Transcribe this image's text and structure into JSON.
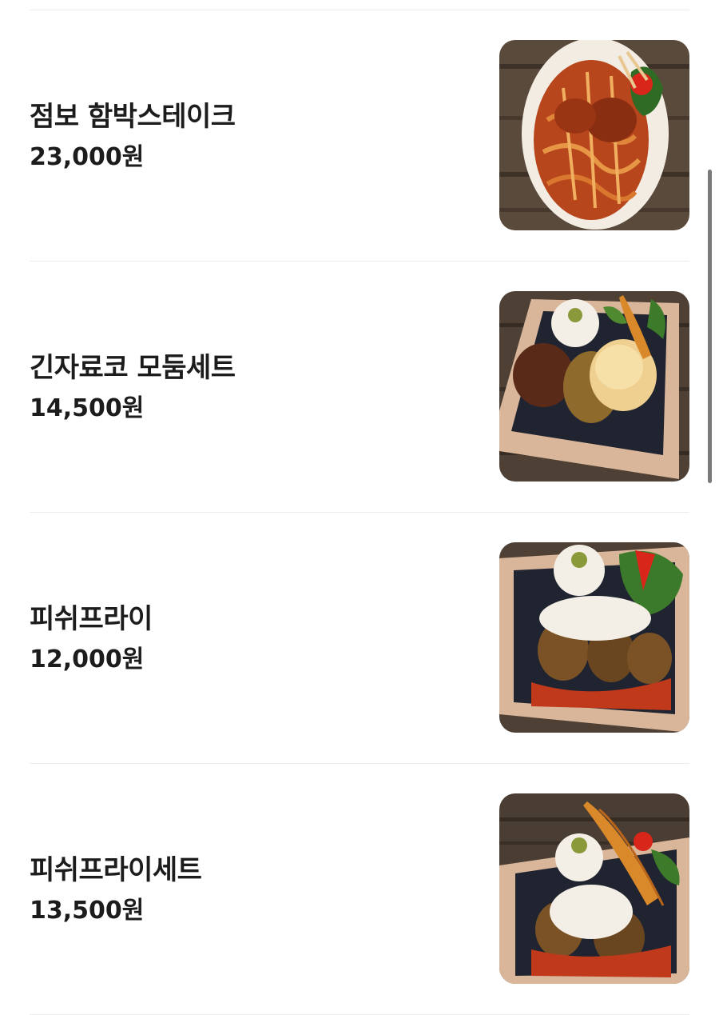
{
  "menu": {
    "items": [
      {
        "name": "점보 함박스테이크",
        "price": "23,000원",
        "image_icon": "hamburg-steak-pasta-photo"
      },
      {
        "name": "긴자료코 모둠세트",
        "price": "14,500원",
        "image_icon": "assorted-set-tray-photo"
      },
      {
        "name": "피쉬프라이",
        "price": "12,000원",
        "image_icon": "fish-fry-tray-photo"
      },
      {
        "name": "피쉬프라이세트",
        "price": "13,500원",
        "image_icon": "fish-fry-set-tray-photo"
      }
    ]
  },
  "colors": {
    "text": "#1c1c1c",
    "divider": "#ececec",
    "scrollbar": "#7a7a7a",
    "wood": "#5a4a3c",
    "tray": "#d9b69a",
    "sauce": "#c0391a"
  }
}
